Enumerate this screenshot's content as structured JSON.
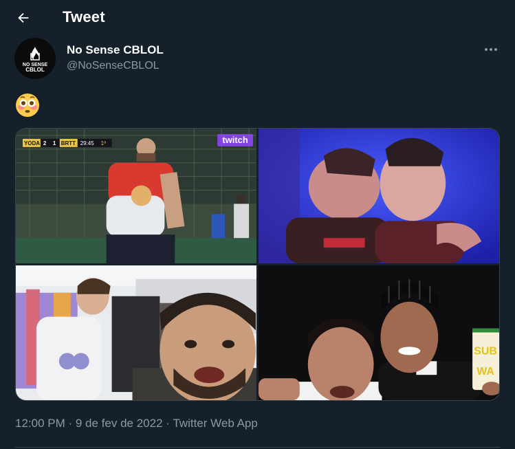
{
  "header": {
    "back_icon": "arrow-left-icon",
    "title": "Tweet"
  },
  "author": {
    "display_name": "No Sense CBLOL",
    "handle": "@NoSenseCBLOL",
    "avatar_text_top": "NO SENSE",
    "avatar_text_bottom": "CBLOL",
    "more_icon": "ellipsis-icon"
  },
  "tweet": {
    "emoji": "flushed-face-emoji"
  },
  "media": [
    {
      "scoreboard": {
        "team_a": "YODA",
        "score_a": "2",
        "score_b": "1",
        "team_b": "BRTT",
        "clock": "29:45",
        "period": "1º"
      },
      "watermark": "twitch"
    },
    {},
    {},
    {
      "cup_text_1": "SUB",
      "cup_text_2": "WA"
    }
  ],
  "meta": {
    "time": "12:00 PM",
    "separator_1": " · ",
    "date": "9 de fev de 2022",
    "separator_2": " · ",
    "source": "Twitter Web App"
  },
  "colors": {
    "background": "#15202b",
    "secondary_text": "#8b98a5",
    "border": "#38444d"
  }
}
